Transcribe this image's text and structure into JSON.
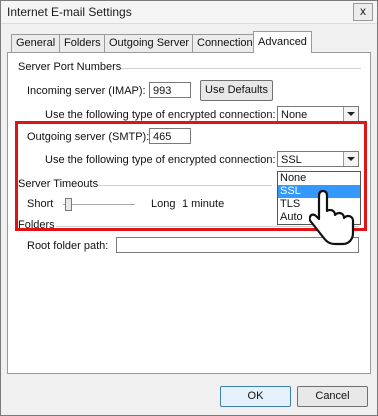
{
  "window": {
    "title": "Internet E-mail Settings",
    "close_glyph": "x"
  },
  "tabs": [
    "General",
    "Folders",
    "Outgoing Server",
    "Connection",
    "Advanced"
  ],
  "server_port_numbers": {
    "group_label": "Server Port Numbers",
    "incoming_label": "Incoming server (IMAP):",
    "incoming_value": "993",
    "use_defaults_label": "Use Defaults",
    "incoming_encryption_label": "Use the following type of encrypted connection:",
    "incoming_encryption_value": "None",
    "outgoing_label": "Outgoing server (SMTP):",
    "outgoing_value": "465",
    "outgoing_encryption_label": "Use the following type of encrypted connection:",
    "outgoing_encryption_value": "SSL",
    "encryption_options": [
      "None",
      "SSL",
      "TLS",
      "Auto"
    ],
    "highlighted_option": "SSL"
  },
  "server_timeouts": {
    "group_label": "Server Timeouts",
    "short_label": "Short",
    "long_label": "Long",
    "timeout_value": "1 minute"
  },
  "folders": {
    "group_label": "Folders",
    "root_label": "Root folder path:",
    "root_value": ""
  },
  "footer": {
    "ok_label": "OK",
    "cancel_label": "Cancel"
  }
}
